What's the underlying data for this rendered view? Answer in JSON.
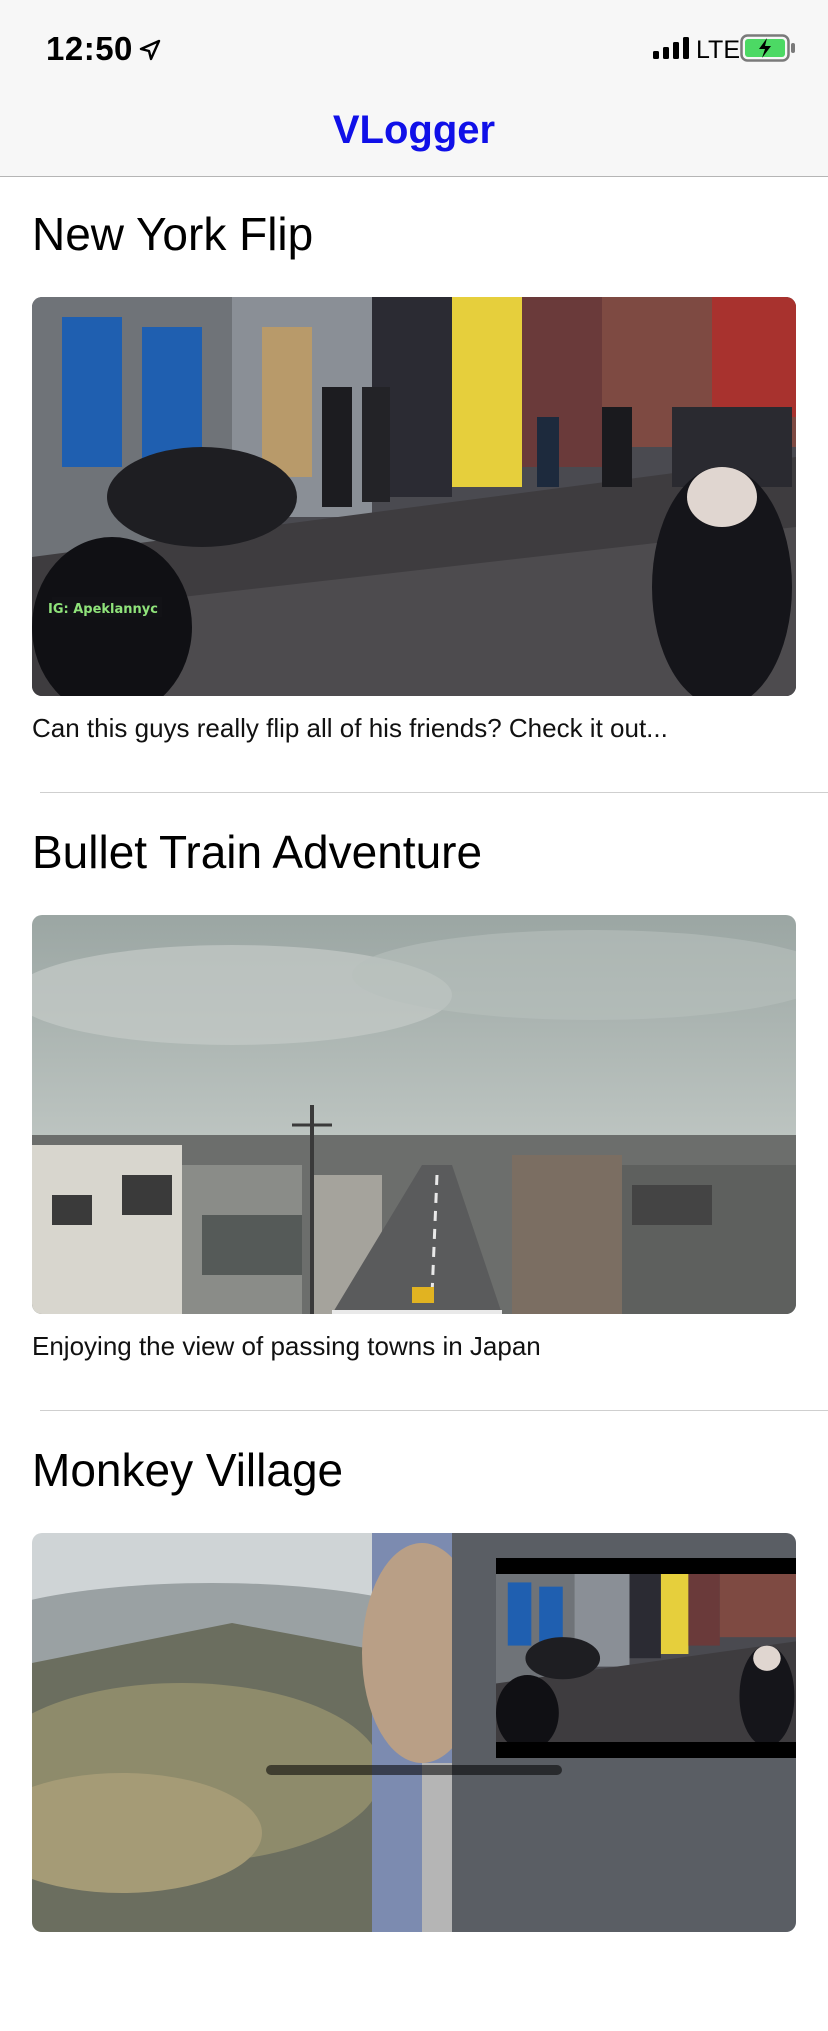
{
  "status_bar": {
    "time": "12:50",
    "network": "LTE",
    "icons": [
      "location-arrow-icon",
      "signal-bars-icon",
      "battery-charging-icon"
    ],
    "battery_color": "#4cd964"
  },
  "nav": {
    "title": "VLogger",
    "title_color": "#1010e8"
  },
  "videos": [
    {
      "title": "New York Flip",
      "description": "Can this guys really flip all of his friends? Check it out..."
    },
    {
      "title": "Bullet Train Adventure",
      "description": "Enjoying the view of passing towns in Japan"
    },
    {
      "title": "Monkey Village",
      "description": ""
    }
  ],
  "pip": {
    "playing": "New York Flip"
  }
}
